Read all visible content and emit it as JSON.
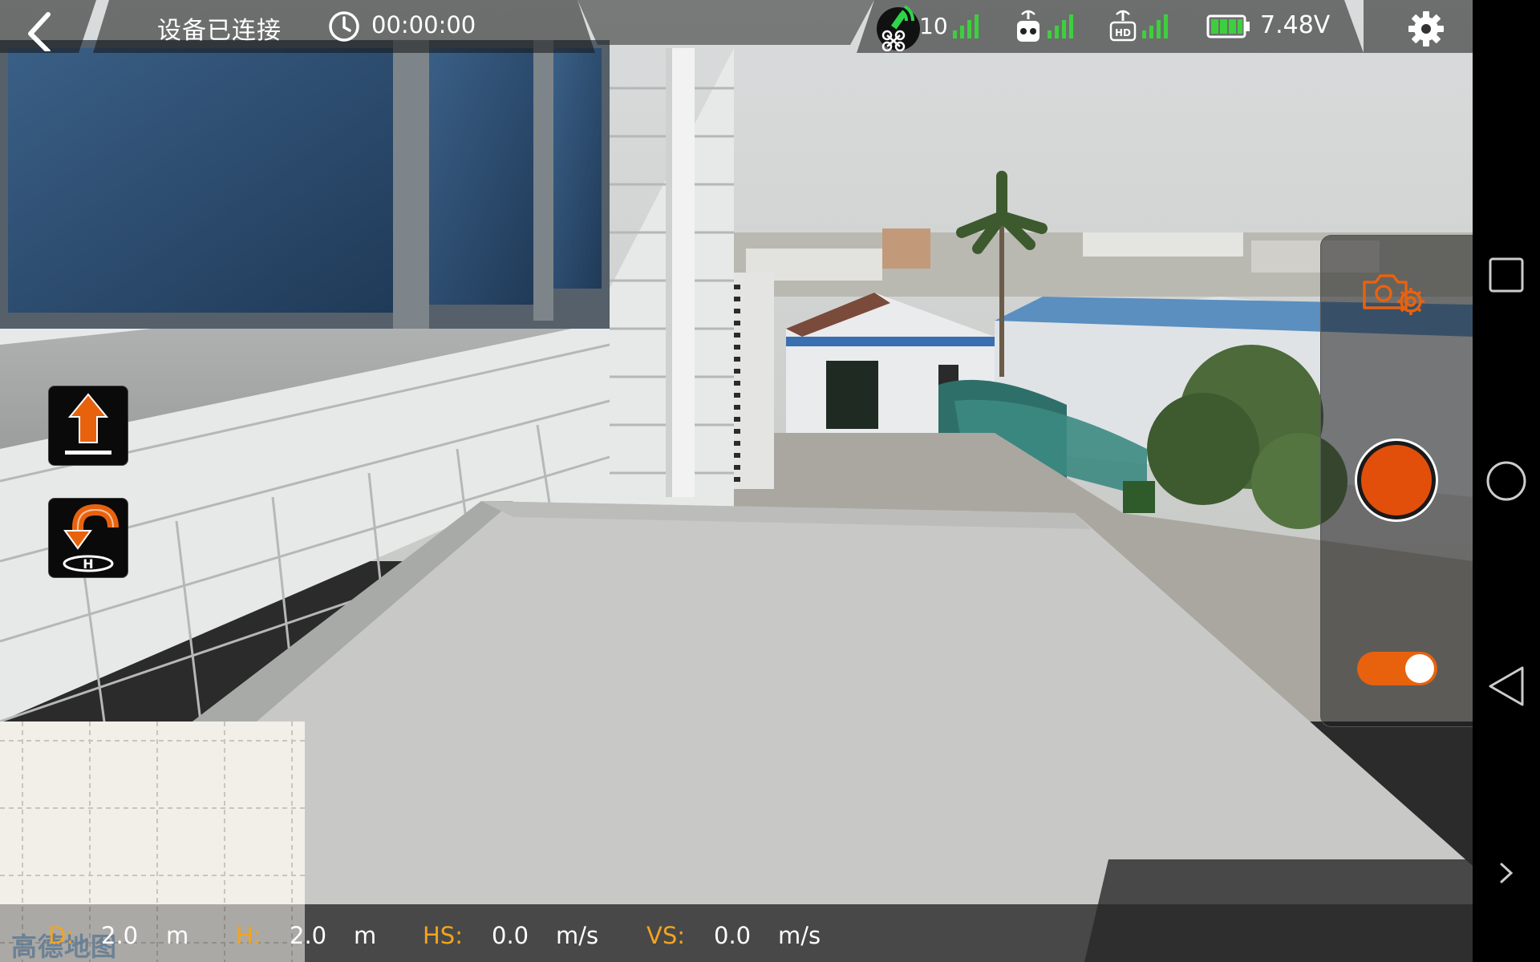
{
  "status_bar": {
    "connection_status": "设备已连接",
    "flight_time": "00:00:00",
    "satellite_count": "10",
    "battery_voltage": "7.48V"
  },
  "icons": {
    "back": "chevron-left-icon",
    "clock": "clock-icon",
    "satellite": "satellite-icon",
    "drone": "drone-icon",
    "remote_controller": "remote-controller-icon",
    "hd_transmission": "hd-video-link-icon",
    "battery": "battery-icon",
    "settings": "gear-icon",
    "takeoff": "takeoff-arrow-icon",
    "return_home": "return-home-icon",
    "camera_settings": "camera-settings-icon"
  },
  "signal_levels": {
    "gps": 4,
    "remote_controller": 4,
    "hd_link": 4
  },
  "battery_level": 1.0,
  "camera_panel": {
    "mode_toggle_on": true
  },
  "minimap": {
    "provider_logo": "高德地图"
  },
  "telemetry": {
    "distance": {
      "label": "D:",
      "value": "2.0",
      "unit": "m"
    },
    "height": {
      "label": "H:",
      "value": "2.0",
      "unit": "m"
    },
    "horizontal_speed": {
      "label": "HS:",
      "value": "0.0",
      "unit": "m/s"
    },
    "vertical_speed": {
      "label": "VS:",
      "value": "0.0",
      "unit": "m/s"
    }
  },
  "colors": {
    "accent": "#e8620e",
    "signal_green": "#3ecf3e",
    "telemetry_label": "#f2a41e"
  }
}
